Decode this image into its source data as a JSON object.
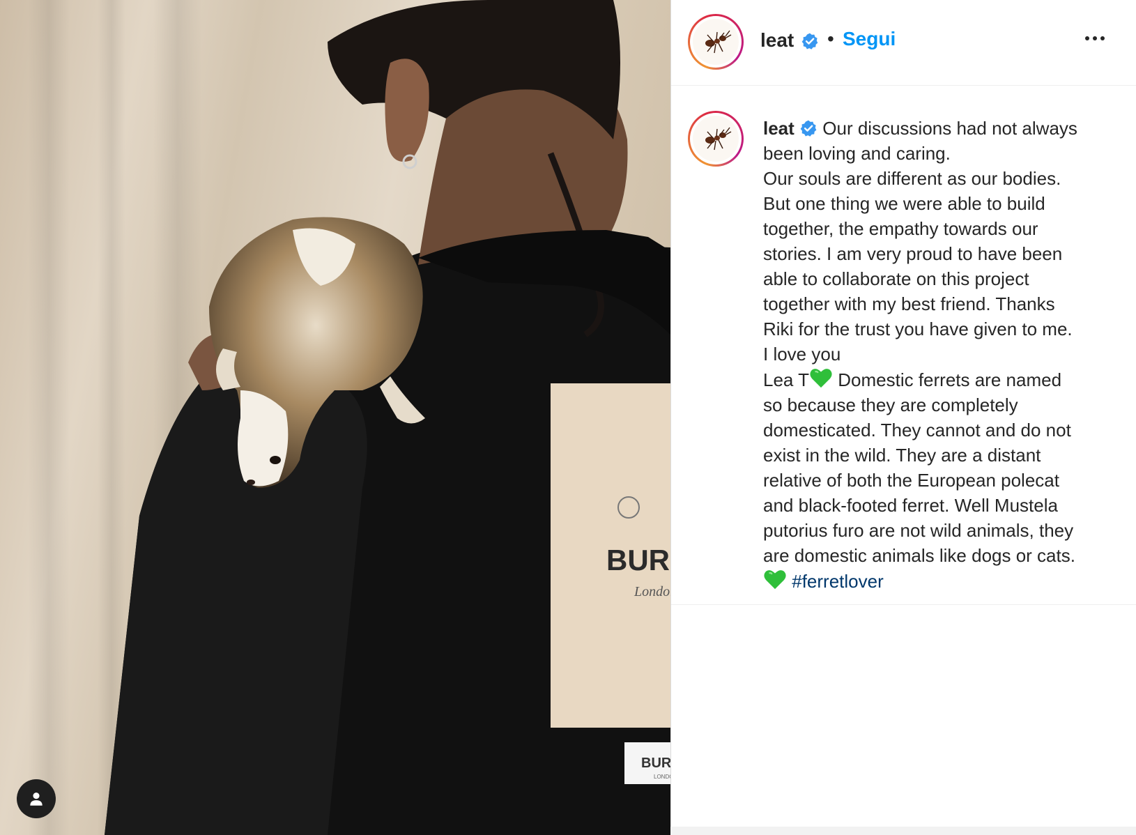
{
  "post": {
    "username": "leat",
    "dot": "•",
    "follow_label": "Segui",
    "photo_print_main": "BURB",
    "photo_print_sub": "London",
    "photo_label_main": "BURI",
    "photo_label_sub": "LONDO"
  },
  "caption": {
    "username": "leat",
    "lines": [
      "Our discussions had not always",
      "been loving and caring.",
      "Our souls are different as our bodies.",
      "But one thing we were able to build",
      "together, the empathy towards our",
      "stories. I am very proud to have been",
      "able to collaborate on this project",
      "together with my best friend. Thanks",
      "Riki for the trust you have given to me.",
      "I love you"
    ],
    "line_lea": "Lea T",
    "after_heart_1": " Domestic ferrets are named",
    "rest_lines": [
      "so because they are completely",
      "domesticated. They cannot and do not",
      "exist in the wild. They are a distant",
      "relative of both the European polecat",
      "and black-footed ferret. Well Mustela",
      "putorius furo are not wild animals, they",
      "are domestic animals like dogs or cats."
    ],
    "hashtag": "#ferretlover"
  },
  "colors": {
    "follow_blue": "#0095f6",
    "hashtag_blue": "#00376b",
    "verified_blue": "#3897f0",
    "green_heart": "#2fbf3a"
  },
  "icons": {
    "verified": "verified-badge-icon",
    "more": "more-options-icon",
    "tag": "user-tag-icon",
    "heart": "green-heart-emoji"
  }
}
